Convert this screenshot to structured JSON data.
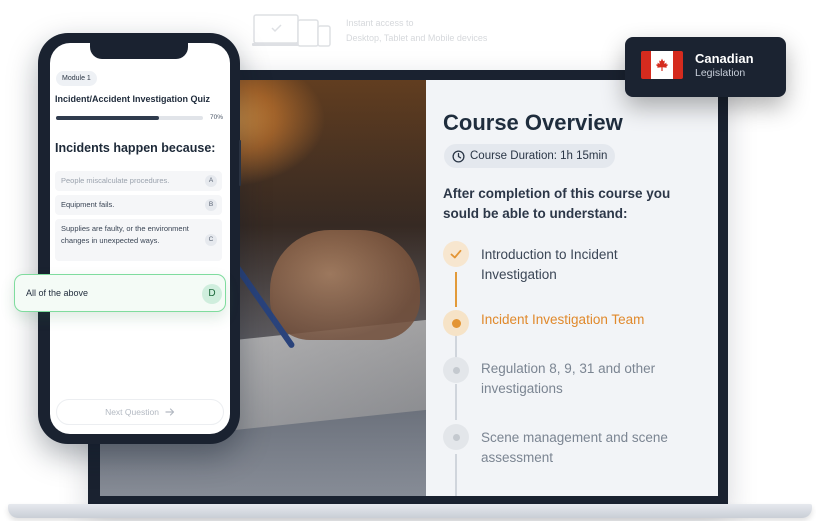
{
  "top_hint": {
    "line1": "Instant access to",
    "line2": "Desktop, Tablet and Mobile devices",
    "icon": "devices-icon"
  },
  "badge": {
    "title": "Canadian",
    "subtitle": "Legislation",
    "icon": "canada-flag-icon",
    "colors": {
      "flag_red": "#d52b1e",
      "background": "#1b2331"
    }
  },
  "course": {
    "title": "Course Overview",
    "duration": "Course Duration: 1h 15min",
    "intro": "After completion of this course you sould be able to understand:",
    "steps": [
      {
        "label": "Introduction to Incident Investigation",
        "state": "done"
      },
      {
        "label": "Incident Investigation Team",
        "state": "active"
      },
      {
        "label": "Regulation 8, 9, 31 and other investigations",
        "state": "pending"
      },
      {
        "label": "Scene management and scene assessment",
        "state": "pending"
      }
    ],
    "accent_color": "#e39433"
  },
  "quiz": {
    "module": "Module 1",
    "title": "Incident/Accident Investigation Quiz",
    "progress_pct": 70,
    "progress_label": "70%",
    "question": "Incidents happen because:",
    "options": [
      {
        "text": "People miscalculate procedures.",
        "letter": "A"
      },
      {
        "text": "Equipment fails.",
        "letter": "B"
      },
      {
        "text": "Supplies are faulty, or the environment changes in unexpected ways.",
        "letter": "C"
      }
    ],
    "selected": {
      "text": "All of the above",
      "letter": "D"
    },
    "next_label": "Next Question",
    "selected_border_color": "#7fdc9e"
  }
}
